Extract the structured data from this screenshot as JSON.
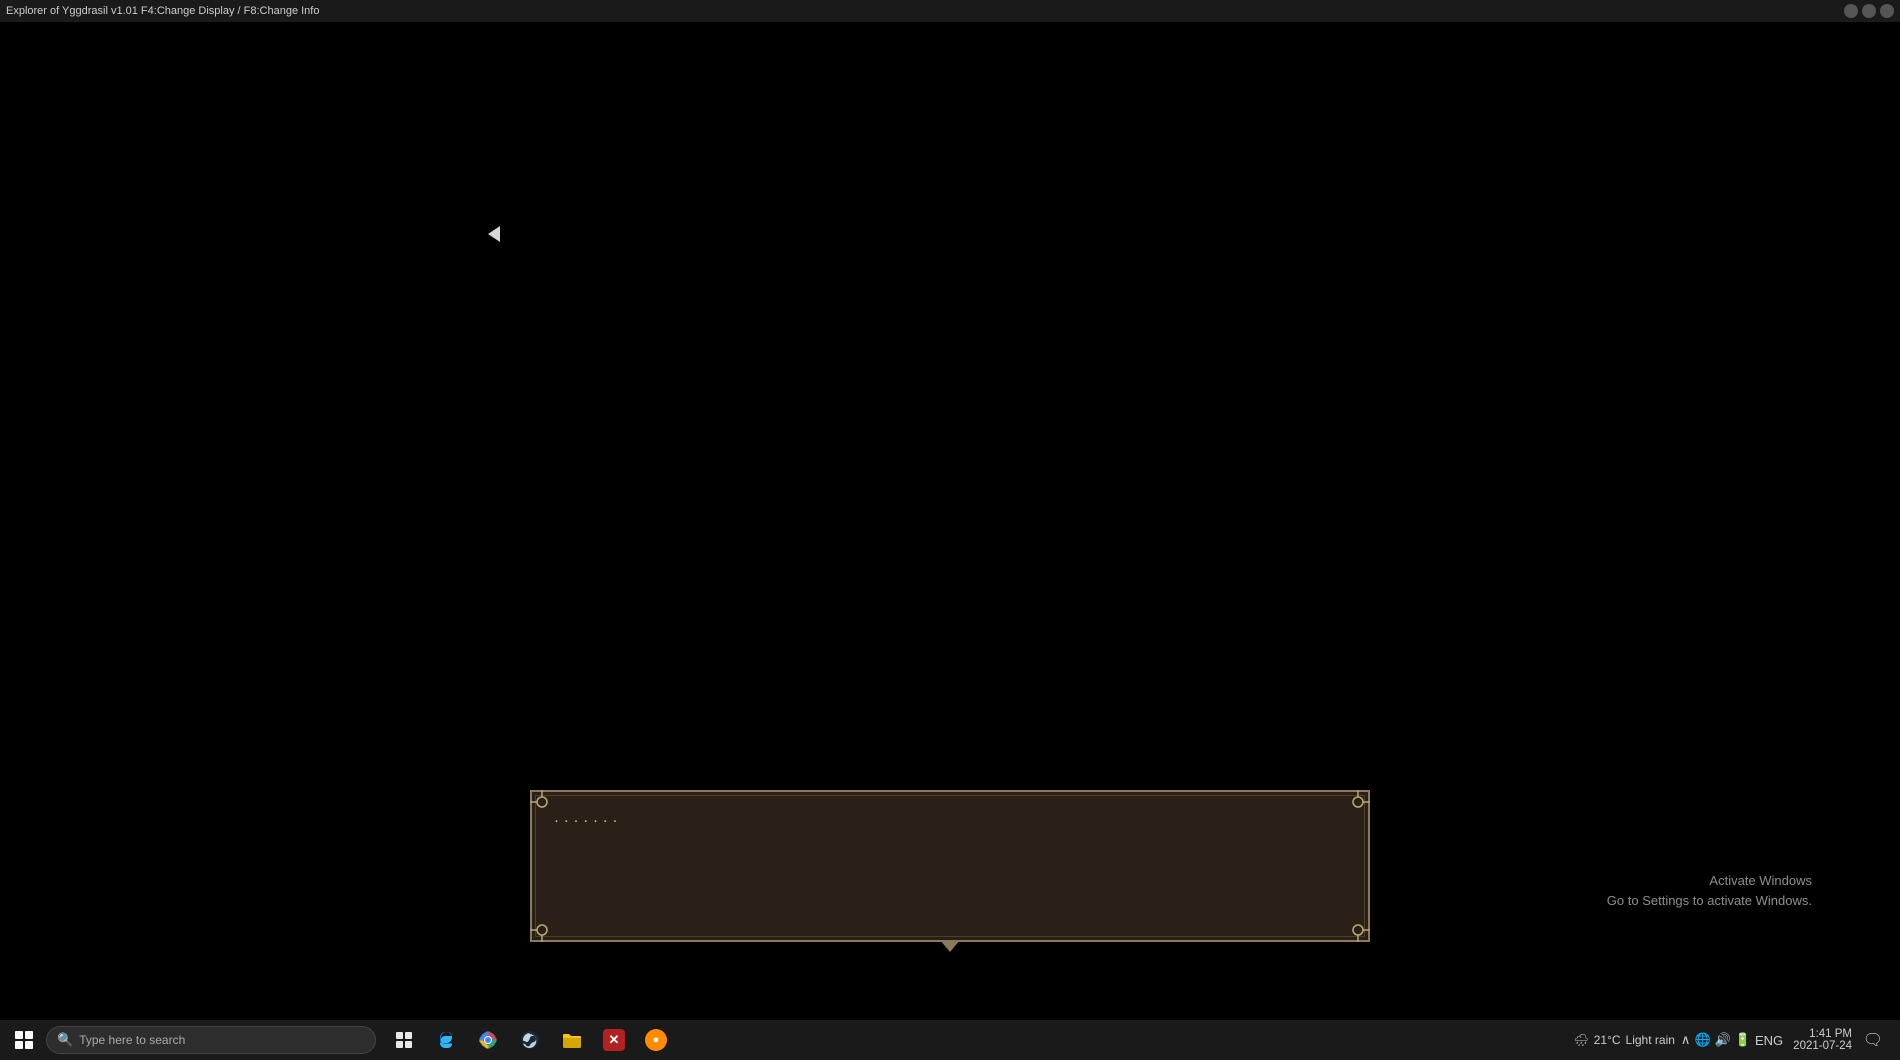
{
  "title_bar": {
    "text": "Explorer of Yggdrasil v1.01    F4:Change Display / F8:Change Info",
    "controls": [
      "minimize",
      "maximize",
      "close"
    ]
  },
  "game": {
    "background": "#000000"
  },
  "dialog": {
    "text": "· · · · · · ·",
    "arrow": "▼"
  },
  "activate_windows": {
    "line1": "Activate Windows",
    "line2": "Go to Settings to activate Windows."
  },
  "taskbar": {
    "search_placeholder": "Type here to search",
    "weather": {
      "temp": "21°C",
      "condition": "Light rain"
    },
    "clock": {
      "time": "1:41 PM",
      "date": "2021-07-24"
    },
    "language": "ENG",
    "icons": [
      {
        "name": "task-view",
        "symbol": "⧉"
      },
      {
        "name": "edge",
        "symbol": "🌐"
      },
      {
        "name": "chrome",
        "symbol": "⊙"
      },
      {
        "name": "steam",
        "symbol": "♟"
      },
      {
        "name": "explorer",
        "symbol": "📁"
      },
      {
        "name": "app1",
        "symbol": "⬡"
      },
      {
        "name": "app2",
        "symbol": "◉"
      }
    ]
  }
}
